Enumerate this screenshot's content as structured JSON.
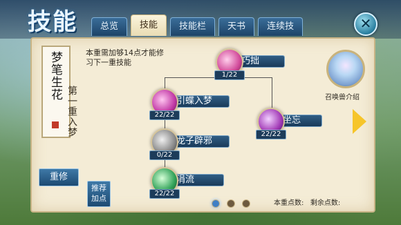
{
  "window": {
    "title": "技能"
  },
  "tabs": [
    {
      "label": "总览"
    },
    {
      "label": "技能",
      "active": true
    },
    {
      "label": "技能栏"
    },
    {
      "label": "天书"
    },
    {
      "label": "连续技"
    }
  ],
  "close_icon": "close-x-icon",
  "book": {
    "title": "梦笔生花",
    "stage": "第一重入梦"
  },
  "hint": "本重需加够14点才能修习下一重技能",
  "buttons": {
    "reset": "重修",
    "save": "推荐加点"
  },
  "skills": [
    {
      "name": "巧拙",
      "level": "1/22",
      "icon": "pink-orb-icon",
      "color": "#d24a9a"
    },
    {
      "name": "引蝶入梦",
      "level": "22/22",
      "icon": "magenta-butterfly-icon",
      "color": "#c23aa6"
    },
    {
      "name": "坐忘",
      "level": "22/22",
      "icon": "purple-lotus-icon",
      "color": "#a23ab6"
    },
    {
      "name": "龙子辟邪",
      "level": "0/22",
      "icon": "grey-dragon-icon",
      "color": "#8a8a8a"
    },
    {
      "name": "涓流",
      "level": "22/22",
      "icon": "green-stream-icon",
      "color": "#33a35a"
    }
  ],
  "pet": {
    "label": "召唤兽介绍",
    "icon": "pet-portrait-icon"
  },
  "next_arrow_icon": "chevron-right-icon",
  "pagination": {
    "pages": 3,
    "current": 1
  },
  "points": {
    "this_label": "本重点数:",
    "this_value": "",
    "remain_label": "剩余点数:",
    "remain_value": ""
  }
}
